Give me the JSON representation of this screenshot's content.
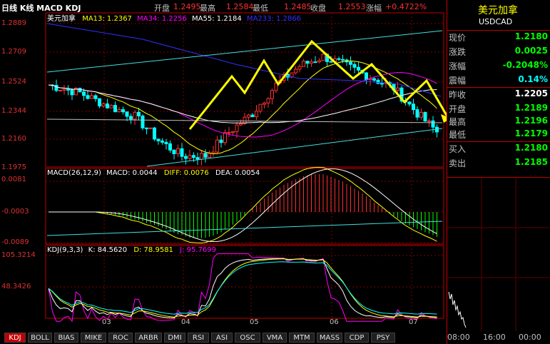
{
  "header": {
    "title": "日线 K线 MACD KDJ",
    "open_label": "开盘",
    "open_value": "1.2495",
    "high_label": "最高",
    "high_value": "1.2584",
    "low_label": "最低",
    "low_value": "1.2485",
    "close_label": "收盘",
    "close_value": "1.2553",
    "change_label": "涨幅",
    "change_value": "+0.4722%"
  },
  "price_panel": {
    "symbol": "美元加拿",
    "ma13": "MA13: 1.2367",
    "ma34": "MA34: 1.2256",
    "ma55": "MA55: 1.2184",
    "ma233": "MA233: 1.2866",
    "ticks": [
      "1.2889",
      "1.2709",
      "1.2524",
      "1.2344",
      "1.2160",
      "1.1975"
    ]
  },
  "macd_panel": {
    "label": "MACD(26,12,9)",
    "macd": "MACD: 0.0044",
    "diff": "DIFF: 0.0076",
    "dea": "DEA: 0.0054",
    "ticks": [
      "0.0081",
      "-0.0003",
      "-0.0089"
    ]
  },
  "kdj_panel": {
    "label": "KDJ(9,3,3)",
    "k": "K: 84.5620",
    "d": "D: 78.9581",
    "j": "J: 95.7699",
    "ticks": [
      "105.3214",
      "48.3426"
    ]
  },
  "months": [
    "03",
    "04",
    "05",
    "06",
    "07"
  ],
  "tabs": [
    "KDJ",
    "BOLL",
    "BIAS",
    "MIKE",
    "ROC",
    "ARBR",
    "DMI",
    "RSI",
    "ASI",
    "OSC",
    "VMA",
    "MTM",
    "MASS",
    "CDP",
    "PSY"
  ],
  "quote": {
    "name": "美元加拿",
    "code": "USDCAD",
    "rows": [
      {
        "label": "现价",
        "value": "1.2180",
        "color": "#00ff00"
      },
      {
        "label": "涨跌",
        "value": "0.0025",
        "color": "#00ff00"
      },
      {
        "label": "涨幅",
        "value": "-0.2048%",
        "color": "#00ff00"
      },
      {
        "label": "震幅",
        "value": "0.14%",
        "color": "#00ffff"
      },
      {
        "label": "昨收",
        "value": "1.2205",
        "color": "#ffffff"
      },
      {
        "label": "开盘",
        "value": "1.2189",
        "color": "#00ff00"
      },
      {
        "label": "最高",
        "value": "1.2196",
        "color": "#00ff00"
      },
      {
        "label": "最低",
        "value": "1.2179",
        "color": "#00ff00"
      },
      {
        "label": "买入",
        "value": "1.2180",
        "color": "#00ff00"
      },
      {
        "label": "卖出",
        "value": "1.2185",
        "color": "#00ff00"
      }
    ],
    "times": [
      "08:00",
      "16:00",
      "00:00"
    ]
  },
  "colors": {
    "up": "#ff3030",
    "down": "#00ffff",
    "ma13": "#ffff00",
    "ma34": "#ff00ff",
    "ma55": "#ffffff",
    "ma233": "#3030ff",
    "trend": "#ffff00"
  }
}
